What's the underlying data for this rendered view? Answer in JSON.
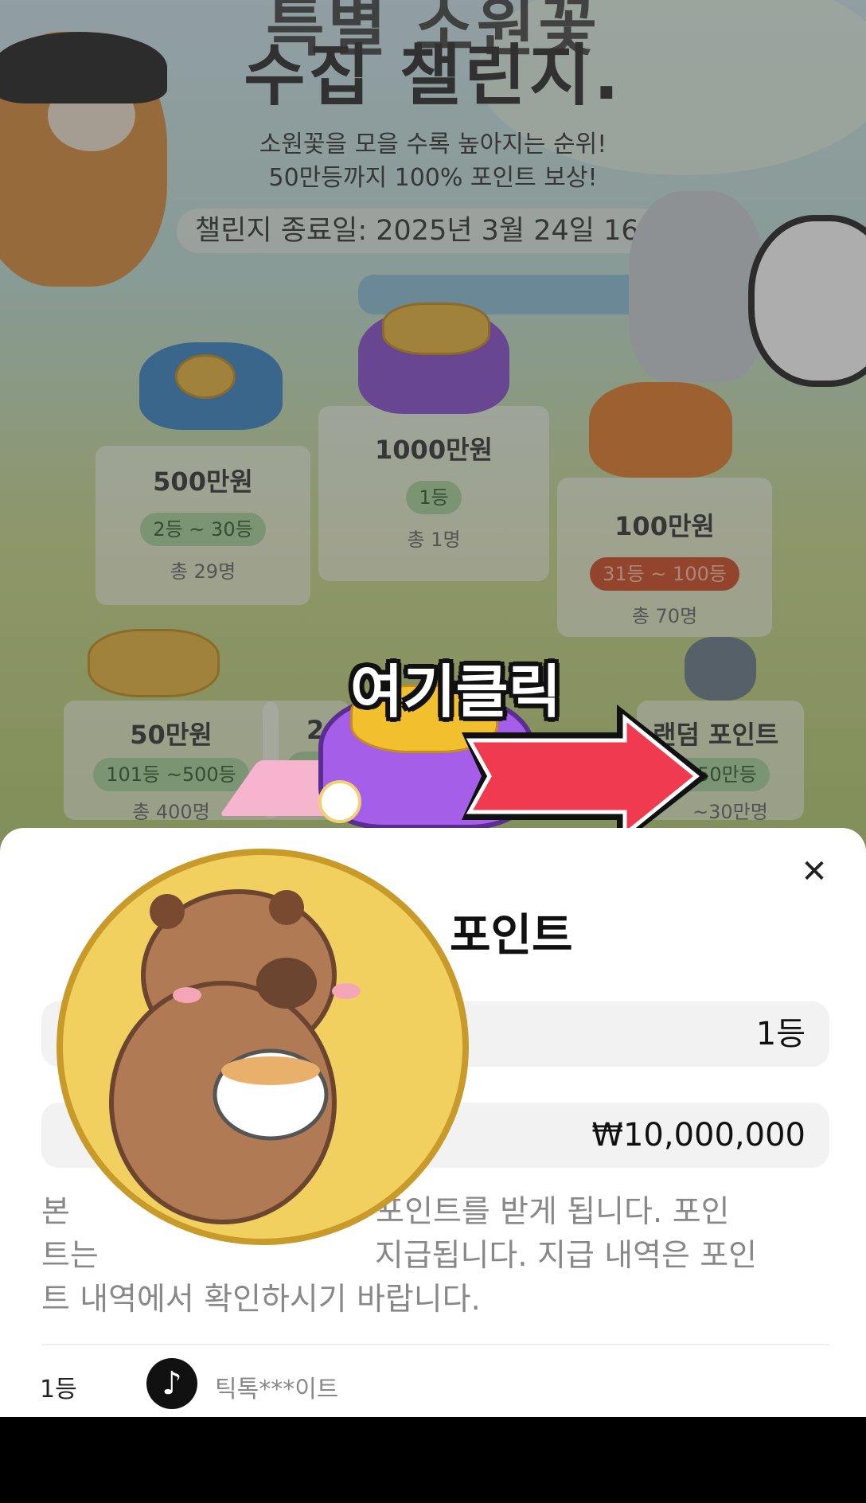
{
  "header": {
    "title_line1": "특별 소원꽃",
    "title_line2": "수집 챌린지.",
    "subtitle_line1": "소원꽃을 모을 수록 높아지는 순위!",
    "subtitle_line2": "50만등까지 100% 포인트 보상!",
    "end_date": "챌린지 종료일: 2025년 3월 24일 16:00"
  },
  "prizes": [
    {
      "amount": "500만원",
      "rank": "2등 ~ 30등",
      "total": "총 29명"
    },
    {
      "amount": "1000만원",
      "rank": "1등",
      "total": "총 1명"
    },
    {
      "amount": "100만원",
      "rank": "31등 ~ 100등",
      "total": "총 70명"
    },
    {
      "amount": "50만원",
      "rank": "101등 ~500등",
      "total": "총 400명"
    },
    {
      "amount": "2",
      "rank": "~ 2",
      "total": ""
    },
    {
      "amount": "랜덤 포인트",
      "rank": "~50만등",
      "total": "~30만명"
    }
  ],
  "overlay": {
    "click_here": "여기클릭"
  },
  "sheet": {
    "title": "포인트",
    "close_icon": "close-icon",
    "rank_value": "1등",
    "amount_value": "₩10,000,000",
    "description": "본 포인트를 받게 됩니다. 포인트는 지급됩니다. 지급 내역은 포인트 내역에서 확인하시기 바랍니다.",
    "desc_line1": "본                               포인트를 받게 됩니다. 포인",
    "desc_line2": "트는                            지급됩니다. 지급 내역은 포인",
    "desc_line3": "트 내역에서 확인하시기 바랍니다.",
    "winner": {
      "rank": "1등",
      "avatar_icon": "tiktok-icon",
      "name": "틱톡***이트"
    }
  },
  "colors": {
    "arrow": "#f03a4f",
    "sheet_bg": "#ffffff",
    "badge_green": "#a9d59b",
    "badge_red": "#d24b22"
  }
}
